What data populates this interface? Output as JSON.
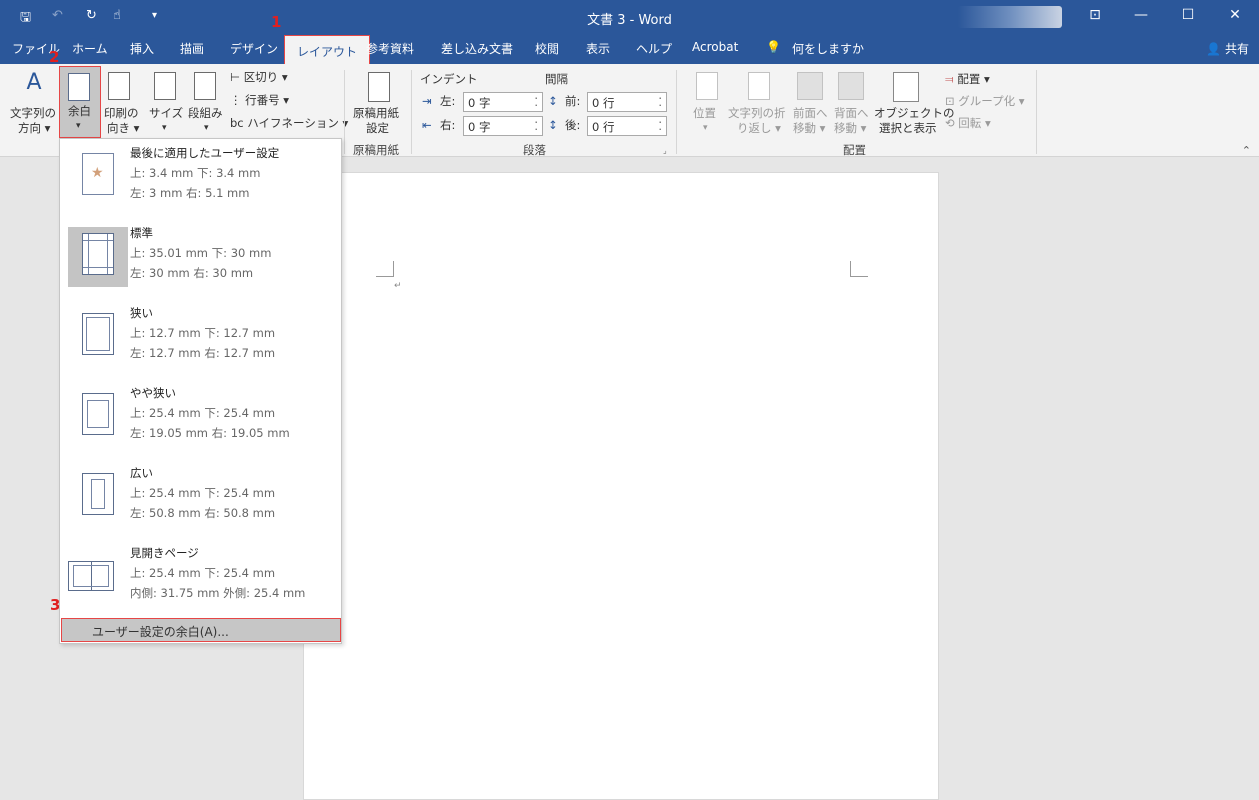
{
  "titlebar": {
    "title": "文書 3  -  Word",
    "qa_save": "🖫",
    "qa_undo": "↶",
    "qa_redo": "↻",
    "qa_touch": "☝",
    "qa_more": "▾",
    "win_ribbon": "⊡",
    "win_min": "—",
    "win_max": "☐",
    "win_close": "✕"
  },
  "tabs": [
    "ファイル",
    "ホーム",
    "挿入",
    "描画",
    "デザイン",
    "レイアウト",
    "参考資料",
    "差し込み文書",
    "校閲",
    "表示",
    "ヘルプ",
    "Acrobat",
    "何をしますか"
  ],
  "share": "共有",
  "ribbon": {
    "text_direction": [
      "文字列の",
      "方向 ▾"
    ],
    "margins": [
      "余白",
      "▾"
    ],
    "orientation": [
      "印刷の",
      "向き ▾"
    ],
    "size": [
      "サイズ",
      "▾"
    ],
    "columns": [
      "段組み",
      "▾"
    ],
    "breaks": "区切り ▾",
    "line_numbers": "行番号 ▾",
    "hyphenation": "ハイフネーション ▾",
    "genko_setting": [
      "原稿用紙",
      "設定"
    ],
    "genko_group": "原稿用紙",
    "indent_label": "インデント",
    "spacing_label": "間隔",
    "indent_left_label": "左:",
    "indent_left_value": "0 字",
    "indent_right_label": "右:",
    "indent_right_value": "0 字",
    "space_before_label": "前:",
    "space_before_value": "0 行",
    "space_after_label": "後:",
    "space_after_value": "0 行",
    "paragraph_group": "段落",
    "position": [
      "位置",
      "▾"
    ],
    "wrap_text": [
      "文字列の折",
      "り返し ▾"
    ],
    "bring_forward": [
      "前面へ",
      "移動 ▾"
    ],
    "send_backward": [
      "背面へ",
      "移動 ▾"
    ],
    "selection_pane": [
      "オブジェクトの",
      "選択と表示"
    ],
    "align": "配置 ▾",
    "group": "グループ化 ▾",
    "rotate": "回転 ▾",
    "arrange_group": "配置"
  },
  "margin_options": [
    {
      "name": "最後に適用したユーザー設定",
      "row1": "上:      3.4 mm   下:       3.4 mm",
      "row2": "左:        3 mm   右:       5.1 mm"
    },
    {
      "name": "標準",
      "row1": "上:     35.01 mm  下:      30 mm",
      "row2": "左:     30 mm      右:      30 mm"
    },
    {
      "name": "狭い",
      "row1": "上:     12.7 mm    下:      12.7 mm",
      "row2": "左:     12.7 mm    右:      12.7 mm"
    },
    {
      "name": "やや狭い",
      "row1": "上:     25.4 mm    下:      25.4 mm",
      "row2": "左:     19.05 mm  右:     19.05 mm"
    },
    {
      "name": "広い",
      "row1": "上:     25.4 mm    下:      25.4 mm",
      "row2": "左:     50.8 mm    右:      50.8 mm"
    },
    {
      "name": "見開きページ",
      "row1": "上:     25.4 mm    下:      25.4 mm",
      "row2": "内側: 31.75 mm  外側:  25.4 mm"
    }
  ],
  "custom_margins": "ユーザー設定の余白(A)...",
  "badges": {
    "b1": "1",
    "b2": "2",
    "b3": "3"
  },
  "colors": {
    "word_blue": "#2b579a",
    "highlight_red": "#e64646",
    "badge_red": "#e02020"
  }
}
